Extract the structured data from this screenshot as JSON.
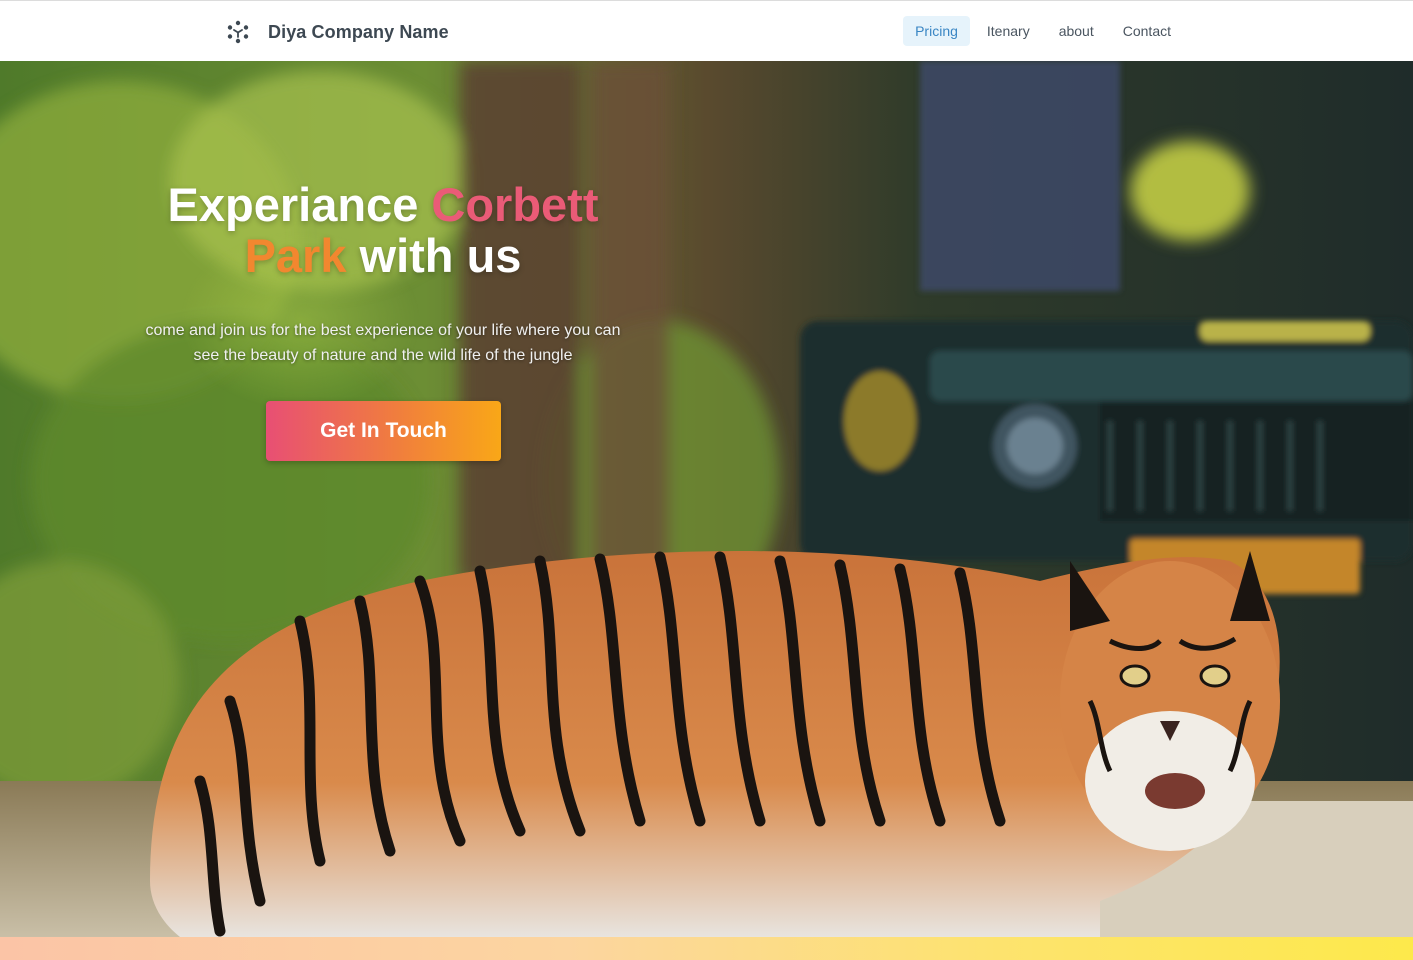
{
  "header": {
    "brand_name": "Diya Company Name",
    "logo_icon": "cube-dots-icon",
    "nav": [
      {
        "label": "Pricing",
        "active": true
      },
      {
        "label": "Itenary",
        "active": false
      },
      {
        "label": "about",
        "active": false
      },
      {
        "label": "Contact",
        "active": false
      }
    ]
  },
  "hero": {
    "title_part1": "Experiance ",
    "title_part2": "Corbett",
    "title_part3": "Park",
    "title_part4": " with us",
    "subtitle": "come and join us for the best experience of your life where you can see the beauty of nature and the wild life of the jungle",
    "cta_label": "Get In Touch",
    "background_image": "tiger-in-jungle-with-safari-jeep"
  },
  "colors": {
    "accent_pink": "#ea5b77",
    "accent_orange": "#f2872f",
    "nav_active_bg": "#e6f3fb",
    "nav_active_text": "#3a86c4"
  }
}
